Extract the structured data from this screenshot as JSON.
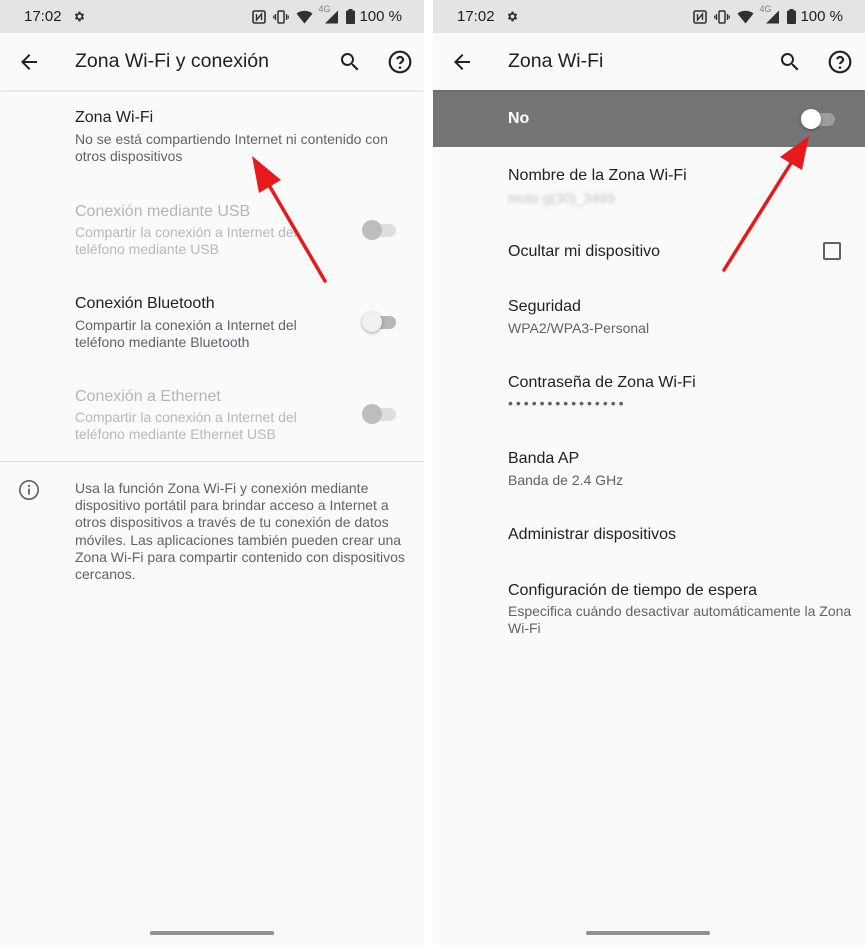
{
  "status_bar": {
    "time": "17:02",
    "network": "4G",
    "battery": "100 %"
  },
  "left_screen": {
    "title": "Zona Wi-Fi y conexión",
    "items": [
      {
        "title": "Zona Wi-Fi",
        "subtitle": "No se está compartiendo Internet ni contenido con otros dispositivos"
      },
      {
        "title": "Conexión mediante USB",
        "subtitle": "Compartir la conexión a Internet del teléfono mediante USB"
      },
      {
        "title": "Conexión Bluetooth",
        "subtitle": "Compartir la conexión a Internet del teléfono mediante Bluetooth"
      },
      {
        "title": "Conexión a Ethernet",
        "subtitle": "Compartir la conexión a Internet del teléfono mediante Ethernet USB"
      }
    ],
    "info_text": "Usa la función Zona Wi-Fi y conexión mediante dispositivo portátil para brindar acceso a Internet a otros dispositivos a través de tu conexión de datos móviles. Las aplicaciones también pueden crear una Zona Wi-Fi para compartir contenido con dispositivos cercanos."
  },
  "right_screen": {
    "title": "Zona Wi-Fi",
    "master_switch": {
      "label": "No"
    },
    "items": [
      {
        "title": "Nombre de la Zona Wi-Fi",
        "subtitle": "moto g(30)_3499"
      },
      {
        "title": "Ocultar mi dispositivo"
      },
      {
        "title": "Seguridad",
        "subtitle": "WPA2/WPA3-Personal"
      },
      {
        "title": "Contraseña de Zona Wi-Fi",
        "subtitle": "•••••••••••••••"
      },
      {
        "title": "Banda AP",
        "subtitle": "Banda de 2.4 GHz"
      },
      {
        "title": "Administrar dispositivos"
      },
      {
        "title": "Configuración de tiempo de espera",
        "subtitle": "Especifica cuándo desactivar automáticamente la Zona Wi-Fi"
      }
    ]
  },
  "colors": {
    "accent_arrow": "#e8191a",
    "master_bar": "#757575",
    "status_bar": "#e4e4e4",
    "background": "#fafafa"
  }
}
